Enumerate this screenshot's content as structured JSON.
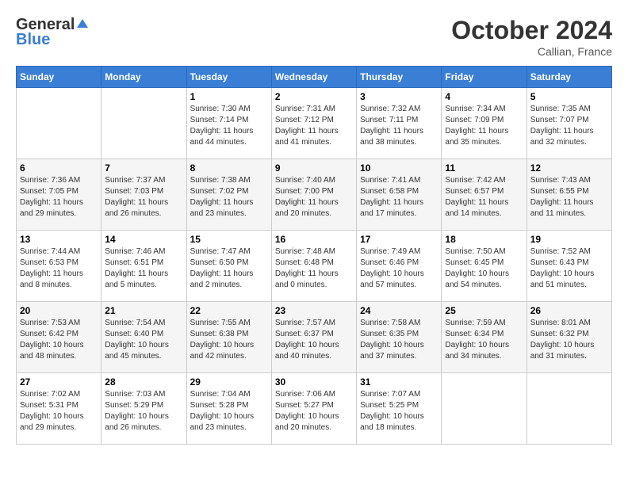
{
  "header": {
    "logo_general": "General",
    "logo_blue": "Blue",
    "month": "October 2024",
    "location": "Callian, France"
  },
  "columns": [
    "Sunday",
    "Monday",
    "Tuesday",
    "Wednesday",
    "Thursday",
    "Friday",
    "Saturday"
  ],
  "weeks": [
    [
      {
        "day": "",
        "sunrise": "",
        "sunset": "",
        "daylight": ""
      },
      {
        "day": "",
        "sunrise": "",
        "sunset": "",
        "daylight": ""
      },
      {
        "day": "1",
        "sunrise": "Sunrise: 7:30 AM",
        "sunset": "Sunset: 7:14 PM",
        "daylight": "Daylight: 11 hours and 44 minutes."
      },
      {
        "day": "2",
        "sunrise": "Sunrise: 7:31 AM",
        "sunset": "Sunset: 7:12 PM",
        "daylight": "Daylight: 11 hours and 41 minutes."
      },
      {
        "day": "3",
        "sunrise": "Sunrise: 7:32 AM",
        "sunset": "Sunset: 7:11 PM",
        "daylight": "Daylight: 11 hours and 38 minutes."
      },
      {
        "day": "4",
        "sunrise": "Sunrise: 7:34 AM",
        "sunset": "Sunset: 7:09 PM",
        "daylight": "Daylight: 11 hours and 35 minutes."
      },
      {
        "day": "5",
        "sunrise": "Sunrise: 7:35 AM",
        "sunset": "Sunset: 7:07 PM",
        "daylight": "Daylight: 11 hours and 32 minutes."
      }
    ],
    [
      {
        "day": "6",
        "sunrise": "Sunrise: 7:36 AM",
        "sunset": "Sunset: 7:05 PM",
        "daylight": "Daylight: 11 hours and 29 minutes."
      },
      {
        "day": "7",
        "sunrise": "Sunrise: 7:37 AM",
        "sunset": "Sunset: 7:03 PM",
        "daylight": "Daylight: 11 hours and 26 minutes."
      },
      {
        "day": "8",
        "sunrise": "Sunrise: 7:38 AM",
        "sunset": "Sunset: 7:02 PM",
        "daylight": "Daylight: 11 hours and 23 minutes."
      },
      {
        "day": "9",
        "sunrise": "Sunrise: 7:40 AM",
        "sunset": "Sunset: 7:00 PM",
        "daylight": "Daylight: 11 hours and 20 minutes."
      },
      {
        "day": "10",
        "sunrise": "Sunrise: 7:41 AM",
        "sunset": "Sunset: 6:58 PM",
        "daylight": "Daylight: 11 hours and 17 minutes."
      },
      {
        "day": "11",
        "sunrise": "Sunrise: 7:42 AM",
        "sunset": "Sunset: 6:57 PM",
        "daylight": "Daylight: 11 hours and 14 minutes."
      },
      {
        "day": "12",
        "sunrise": "Sunrise: 7:43 AM",
        "sunset": "Sunset: 6:55 PM",
        "daylight": "Daylight: 11 hours and 11 minutes."
      }
    ],
    [
      {
        "day": "13",
        "sunrise": "Sunrise: 7:44 AM",
        "sunset": "Sunset: 6:53 PM",
        "daylight": "Daylight: 11 hours and 8 minutes."
      },
      {
        "day": "14",
        "sunrise": "Sunrise: 7:46 AM",
        "sunset": "Sunset: 6:51 PM",
        "daylight": "Daylight: 11 hours and 5 minutes."
      },
      {
        "day": "15",
        "sunrise": "Sunrise: 7:47 AM",
        "sunset": "Sunset: 6:50 PM",
        "daylight": "Daylight: 11 hours and 2 minutes."
      },
      {
        "day": "16",
        "sunrise": "Sunrise: 7:48 AM",
        "sunset": "Sunset: 6:48 PM",
        "daylight": "Daylight: 11 hours and 0 minutes."
      },
      {
        "day": "17",
        "sunrise": "Sunrise: 7:49 AM",
        "sunset": "Sunset: 6:46 PM",
        "daylight": "Daylight: 10 hours and 57 minutes."
      },
      {
        "day": "18",
        "sunrise": "Sunrise: 7:50 AM",
        "sunset": "Sunset: 6:45 PM",
        "daylight": "Daylight: 10 hours and 54 minutes."
      },
      {
        "day": "19",
        "sunrise": "Sunrise: 7:52 AM",
        "sunset": "Sunset: 6:43 PM",
        "daylight": "Daylight: 10 hours and 51 minutes."
      }
    ],
    [
      {
        "day": "20",
        "sunrise": "Sunrise: 7:53 AM",
        "sunset": "Sunset: 6:42 PM",
        "daylight": "Daylight: 10 hours and 48 minutes."
      },
      {
        "day": "21",
        "sunrise": "Sunrise: 7:54 AM",
        "sunset": "Sunset: 6:40 PM",
        "daylight": "Daylight: 10 hours and 45 minutes."
      },
      {
        "day": "22",
        "sunrise": "Sunrise: 7:55 AM",
        "sunset": "Sunset: 6:38 PM",
        "daylight": "Daylight: 10 hours and 42 minutes."
      },
      {
        "day": "23",
        "sunrise": "Sunrise: 7:57 AM",
        "sunset": "Sunset: 6:37 PM",
        "daylight": "Daylight: 10 hours and 40 minutes."
      },
      {
        "day": "24",
        "sunrise": "Sunrise: 7:58 AM",
        "sunset": "Sunset: 6:35 PM",
        "daylight": "Daylight: 10 hours and 37 minutes."
      },
      {
        "day": "25",
        "sunrise": "Sunrise: 7:59 AM",
        "sunset": "Sunset: 6:34 PM",
        "daylight": "Daylight: 10 hours and 34 minutes."
      },
      {
        "day": "26",
        "sunrise": "Sunrise: 8:01 AM",
        "sunset": "Sunset: 6:32 PM",
        "daylight": "Daylight: 10 hours and 31 minutes."
      }
    ],
    [
      {
        "day": "27",
        "sunrise": "Sunrise: 7:02 AM",
        "sunset": "Sunset: 5:31 PM",
        "daylight": "Daylight: 10 hours and 29 minutes."
      },
      {
        "day": "28",
        "sunrise": "Sunrise: 7:03 AM",
        "sunset": "Sunset: 5:29 PM",
        "daylight": "Daylight: 10 hours and 26 minutes."
      },
      {
        "day": "29",
        "sunrise": "Sunrise: 7:04 AM",
        "sunset": "Sunset: 5:28 PM",
        "daylight": "Daylight: 10 hours and 23 minutes."
      },
      {
        "day": "30",
        "sunrise": "Sunrise: 7:06 AM",
        "sunset": "Sunset: 5:27 PM",
        "daylight": "Daylight: 10 hours and 20 minutes."
      },
      {
        "day": "31",
        "sunrise": "Sunrise: 7:07 AM",
        "sunset": "Sunset: 5:25 PM",
        "daylight": "Daylight: 10 hours and 18 minutes."
      },
      {
        "day": "",
        "sunrise": "",
        "sunset": "",
        "daylight": ""
      },
      {
        "day": "",
        "sunrise": "",
        "sunset": "",
        "daylight": ""
      }
    ]
  ]
}
